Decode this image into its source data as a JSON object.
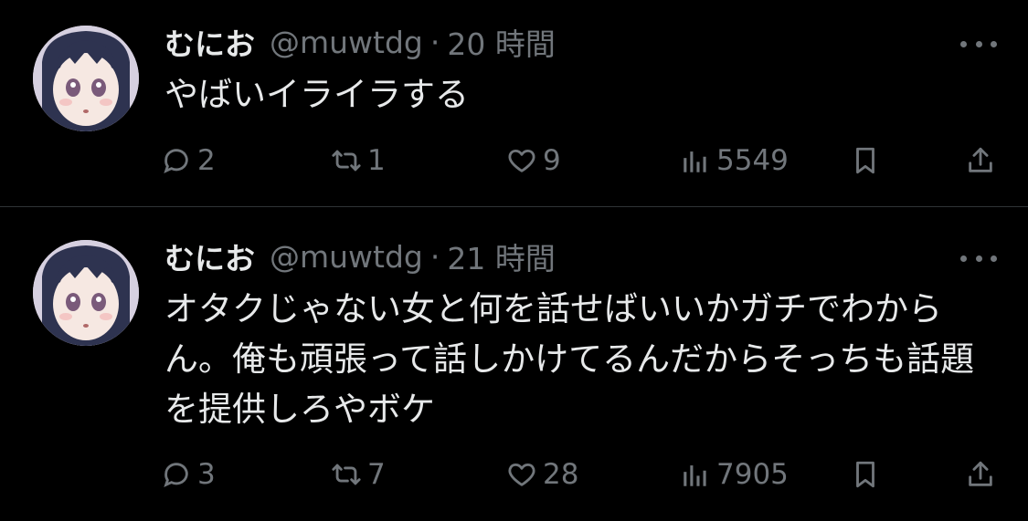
{
  "tweets": [
    {
      "display_name": "むにお",
      "handle": "@muwtdg",
      "separator": "·",
      "time": "20 時間",
      "text": "やばいイライラする",
      "replies": "2",
      "retweets": "1",
      "likes": "9",
      "views": "5549"
    },
    {
      "display_name": "むにお",
      "handle": "@muwtdg",
      "separator": "·",
      "time": "21 時間",
      "text": "オタクじゃない女と何を話せばいいかガチでわからん。俺も頑張って話しかけてるんだからそっちも話題を提供しろやボケ",
      "replies": "3",
      "retweets": "7",
      "likes": "28",
      "views": "7905"
    }
  ],
  "icons": {
    "reply": "reply-icon",
    "retweet": "retweet-icon",
    "like": "heart-icon",
    "views": "views-chart-icon",
    "bookmark": "bookmark-icon",
    "share": "share-icon",
    "more": "more-dots-icon"
  },
  "colors": {
    "background": "#000000",
    "text": "#e7e9ea",
    "muted": "#71767b",
    "divider": "#2f3336"
  }
}
